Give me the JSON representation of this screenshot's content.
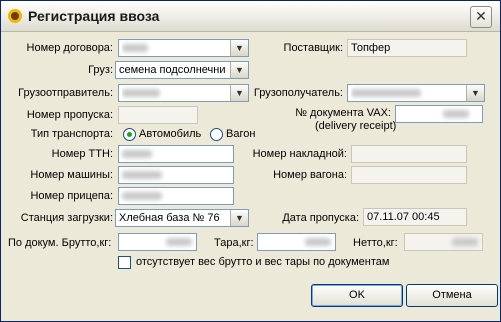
{
  "window": {
    "title": "Регистрация ввоза",
    "icon": "sunflower-icon",
    "close_glyph": "✕"
  },
  "fields": {
    "contract_label": "Номер договора:",
    "supplier_label": "Поставщик:",
    "supplier_value": "Топфер",
    "cargo_label": "Груз:",
    "cargo_value": "семена подсолнечни",
    "shipper_label": "Грузоотправитель:",
    "consignee_label": "Грузополучатель:",
    "pass_number_label": "Номер пропуска:",
    "vax_label": "№ документа VAX:",
    "vax_sublabel": "(delivery receipt)",
    "transport_type_label": "Тип транспорта:",
    "transport_auto": "Автомобиль",
    "transport_wagon": "Вагон",
    "ttn_label": "Номер ТТН:",
    "waybill_label": "Номер накладной:",
    "car_label": "Номер машины:",
    "wagon_label": "Номер вагона:",
    "trailer_label": "Номер прицепа:",
    "station_label": "Станция загрузки:",
    "station_value": "Хлебная база № 76",
    "pass_date_label": "Дата пропуска:",
    "pass_date_value": "07.11.07 00:45",
    "gross_label": "По докум. Брутто,кг:",
    "tare_label": "Тара,кг:",
    "net_label": "Нетто,кг:",
    "no_weight_label": "отсутствует вес брутто и вес тары по документам"
  },
  "buttons": {
    "ok": "OK",
    "cancel": "Отмена"
  },
  "colors": {
    "window_bg": "#ece9d8",
    "radio_selected": "#21a121",
    "border": "#7f9db9"
  }
}
